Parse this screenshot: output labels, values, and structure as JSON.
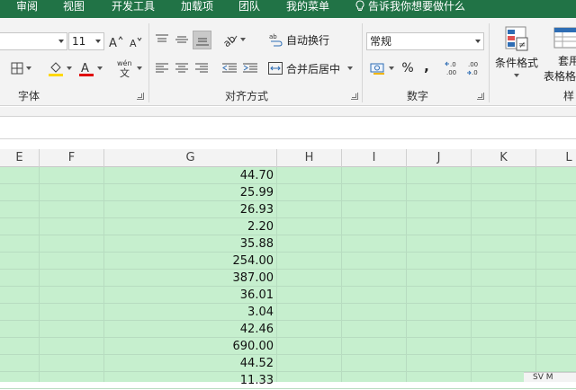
{
  "ribbon_tabs": [
    "审阅",
    "视图",
    "开发工具",
    "加载项",
    "团队",
    "我的菜单"
  ],
  "tell_me": "告诉我你想要做什么",
  "font_group": {
    "font_size": "11",
    "label": "字体"
  },
  "alignment_group": {
    "wrap_text": "自动换行",
    "merge_center": "合并后居中",
    "label": "对齐方式"
  },
  "number_group": {
    "format": "常规",
    "percent": "%",
    "comma": ",",
    "label": "数字"
  },
  "styles_group": {
    "conditional_formatting": "条件格式",
    "format_as_table_line1": "套用",
    "format_as_table_line2": "表格格式",
    "label": "样"
  },
  "columns": [
    "E",
    "F",
    "G",
    "H",
    "I",
    "J",
    "K",
    "L"
  ],
  "column_g_values": [
    "44.70",
    "25.99",
    "26.93",
    "2.20",
    "35.88",
    "254.00",
    "387.00",
    "36.01",
    "3.04",
    "42.46",
    "690.00",
    "44.52",
    "11.33"
  ],
  "status_mini": "SV M"
}
